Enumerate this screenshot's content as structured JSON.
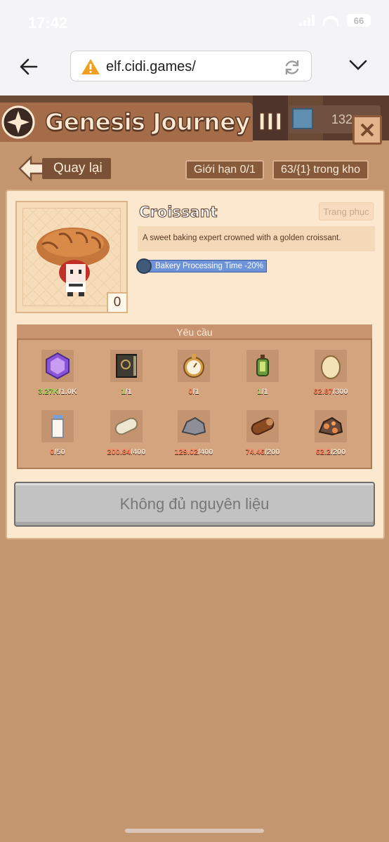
{
  "status_bar": {
    "time": "17:42",
    "battery": "66"
  },
  "browser": {
    "url": "elf.cidi.games/"
  },
  "header": {
    "title": "Genesis Journey III",
    "gem_count": "132"
  },
  "nav": {
    "back_label": "Quay lại",
    "limit_label": "Giới hạn 0/1",
    "stock_label": "63/{1} trong kho"
  },
  "item": {
    "name": "Croissant",
    "type": "Trang phục",
    "description": "A sweet baking expert crowned with a golden croissant.",
    "buff": "Bakery Processing Time -20%",
    "owned": "0"
  },
  "requirements": {
    "title": "Yêu cầu",
    "items": [
      {
        "icon": "purple-crystal-icon",
        "have": "3.27K",
        "need": "/1.0K",
        "ok": true
      },
      {
        "icon": "spell-book-icon",
        "have": "1",
        "need": "/1",
        "ok": true
      },
      {
        "icon": "pocket-watch-icon",
        "have": "0",
        "need": "/1",
        "ok": false
      },
      {
        "icon": "lantern-icon",
        "have": "1",
        "need": "/1",
        "ok": true
      },
      {
        "icon": "egg-icon",
        "have": "62.87",
        "need": "/300",
        "ok": false
      },
      {
        "icon": "milk-bottle-icon",
        "have": "0",
        "need": "/50",
        "ok": false
      },
      {
        "icon": "birch-log-icon",
        "have": "200.84",
        "need": "/400",
        "ok": false
      },
      {
        "icon": "stone-icon",
        "have": "129.02",
        "need": "/400",
        "ok": false
      },
      {
        "icon": "wood-log-icon",
        "have": "74.46",
        "need": "/200",
        "ok": false
      },
      {
        "icon": "copper-ore-icon",
        "have": "62.2",
        "need": "/200",
        "ok": false
      }
    ]
  },
  "action": {
    "label": "Không đủ nguyên liệu"
  },
  "colors": {
    "panel": "#fbe8cf",
    "background": "#c49670",
    "header": "#a46c49",
    "ok": "#9ce05a",
    "low": "#ff7e5a",
    "buff": "#6f93d8"
  }
}
